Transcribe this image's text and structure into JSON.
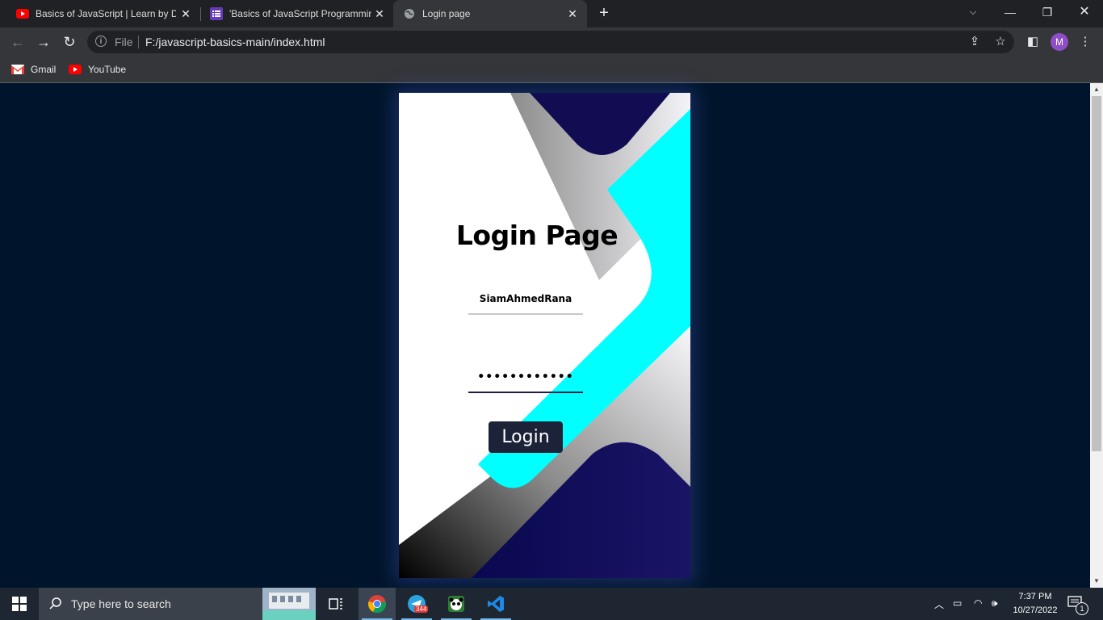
{
  "browser": {
    "tabs": [
      {
        "title": "Basics of JavaScript | Learn by Do",
        "favicon": "youtube-icon",
        "active": false
      },
      {
        "title": "'Basics of JavaScript Programming",
        "favicon": "list-icon",
        "active": false
      },
      {
        "title": "Login page",
        "favicon": "globe-icon",
        "active": true
      }
    ],
    "address": {
      "scheme_label": "File",
      "url": "F:/javascript-basics-main/index.html"
    },
    "profile_initial": "M",
    "bookmarks": [
      {
        "label": "Gmail",
        "icon": "gmail-icon"
      },
      {
        "label": "YouTube",
        "icon": "youtube-icon"
      }
    ]
  },
  "page": {
    "title": "Login Page",
    "username_value": "SiamAhmedRana",
    "password_value": "••••••••••••",
    "login_label": "Login"
  },
  "taskbar": {
    "search_placeholder": "Type here to search",
    "telegram_badge": "344",
    "time": "7:37 PM",
    "date": "10/27/2022",
    "notification_count": "1"
  },
  "colors": {
    "page_bg": "#00152b",
    "cyan": "#00ffff",
    "navy": "#140c55",
    "button_bg": "#1c2238"
  }
}
